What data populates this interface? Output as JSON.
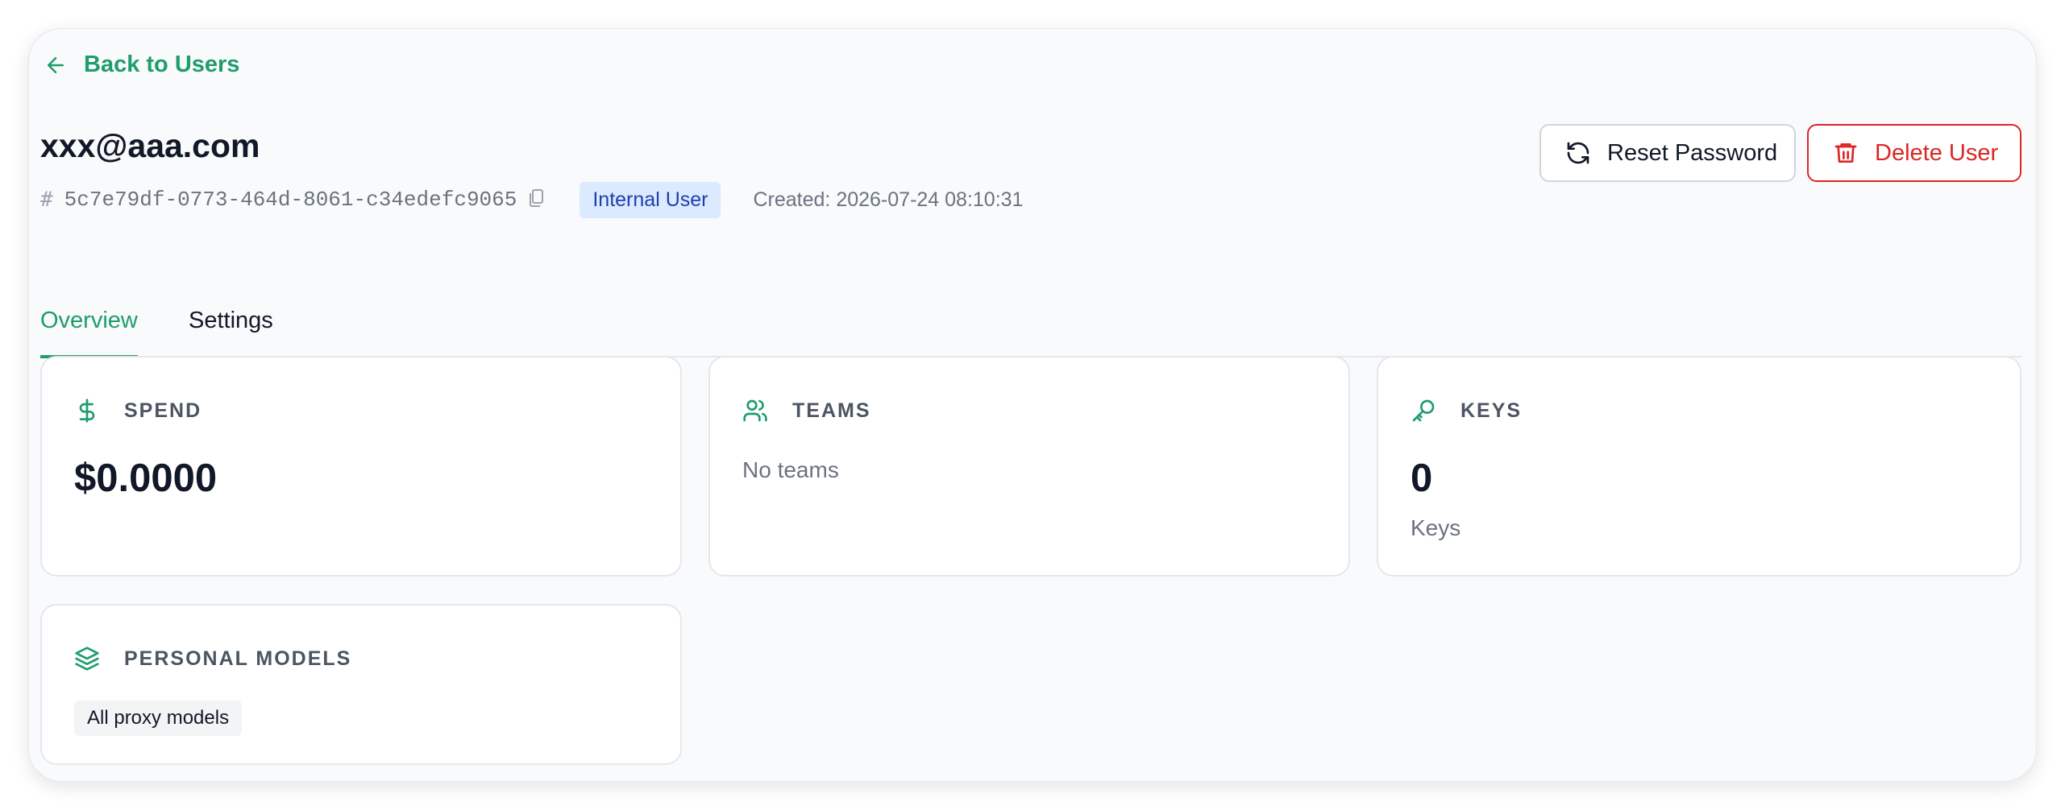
{
  "nav": {
    "back_label": "Back to Users"
  },
  "user": {
    "email": "xxx@aaa.com",
    "hash_symbol": "#",
    "id": "5c7e79df-0773-464d-8061-c34edefc9065",
    "role_badge": "Internal User",
    "created": "Created: 2026-07-24 08:10:31"
  },
  "actions": {
    "reset_label": "Reset Password",
    "delete_label": "Delete User"
  },
  "tabs": [
    {
      "label": "Overview",
      "active": true
    },
    {
      "label": "Settings",
      "active": false
    }
  ],
  "cards": {
    "spend": {
      "label": "SPEND",
      "value": "$0.0000",
      "icon": "dollar-icon"
    },
    "teams": {
      "label": "TEAMS",
      "empty_text": "No teams",
      "icon": "users-icon"
    },
    "keys": {
      "label": "KEYS",
      "value": "0",
      "sub_label": "Keys",
      "icon": "key-icon"
    },
    "personal_models": {
      "label": "PERSONAL MODELS",
      "tag": "All proxy models",
      "icon": "layers-icon"
    }
  },
  "colors": {
    "accent": "#1f9d6b",
    "danger": "#dc2626",
    "badge_bg": "#dbeafe",
    "badge_text": "#1e40af"
  }
}
